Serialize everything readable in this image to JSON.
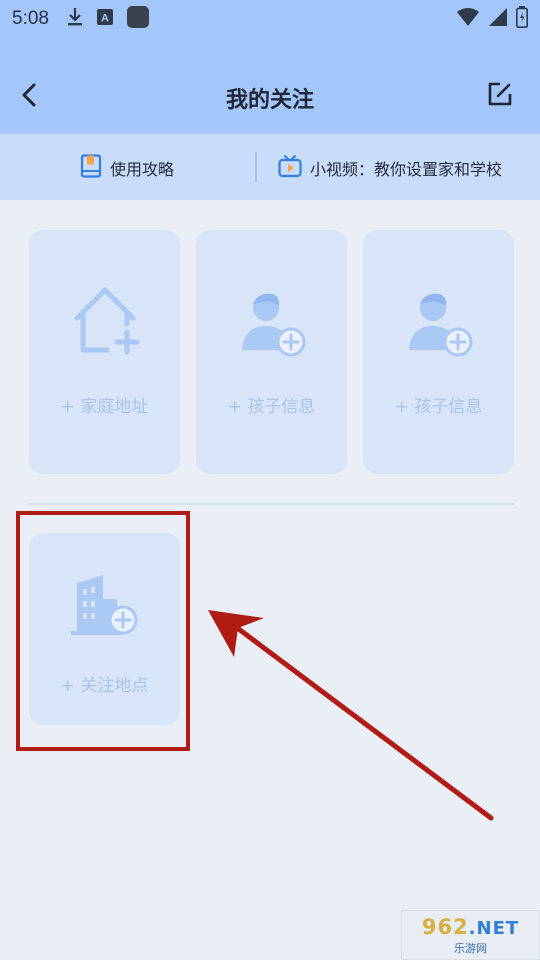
{
  "status_bar": {
    "time": "5:08",
    "left_icons": [
      "download-icon",
      "font-a-icon",
      "app-square-icon"
    ],
    "right_icons": [
      "wifi-icon",
      "signal-icon",
      "battery-icon"
    ]
  },
  "header": {
    "title": "我的关注",
    "back_icon": "chevron-left-icon",
    "edit_icon": "edit-icon",
    "background": "#a3c6fb"
  },
  "info_bar": {
    "guide_label": "使用攻略",
    "video_label": "小视频：教你设置家和学校"
  },
  "cards": [
    {
      "label": "+ 家庭地址",
      "icon": "home-add-icon"
    },
    {
      "label": "+ 孩子信息",
      "icon": "child-add-icon"
    },
    {
      "label": "+ 孩子信息",
      "icon": "child-add-icon"
    }
  ],
  "place_card": {
    "label": "+ 关注地点",
    "icon": "building-add-icon"
  },
  "annotation": {
    "highlight_color": "#b01c14",
    "arrow_color": "#b01c14"
  },
  "watermark": {
    "brand": "962",
    "brand_suffix": ".NET",
    "sub": "乐游网"
  },
  "colors": {
    "accent": "#a3c6fb",
    "card_bg": "#d8e5f8",
    "card_icon": "#a9c8f4",
    "page_bg": "#eaeef5"
  }
}
